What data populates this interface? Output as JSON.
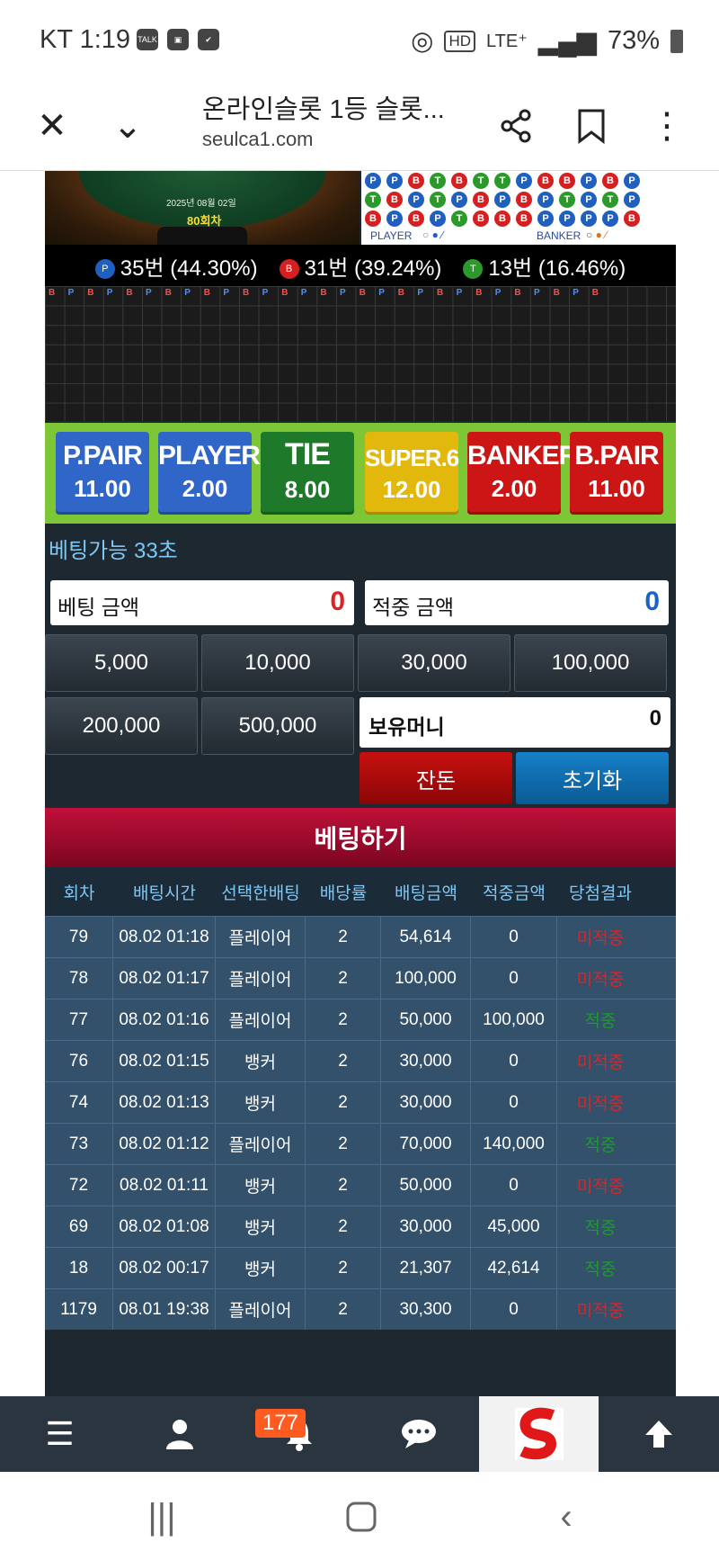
{
  "status_bar": {
    "carrier_time": "KT 1:19",
    "notif_icons": [
      "TALK",
      "▣",
      "✔"
    ],
    "hd": "HD",
    "network": "LTE⁺",
    "battery": "73%"
  },
  "browser": {
    "page_title": "온라인슬롯 1등 슬롯...",
    "url": "seulca1.com"
  },
  "game": {
    "table_date": "2025년 08월 02일",
    "round": "80회차",
    "bead_rows": [
      [
        "P",
        "P",
        "B",
        "T",
        "B",
        "T",
        "T",
        "P",
        "B",
        "B",
        "P",
        "B",
        "P"
      ],
      [
        "T",
        "B",
        "P",
        "T",
        "P",
        "B",
        "P",
        "B",
        "P",
        "T",
        "P",
        "T",
        "P"
      ],
      [
        "B",
        "P",
        "B",
        "P",
        "T",
        "B",
        "B",
        "B",
        "P",
        "P",
        "P",
        "P",
        "B"
      ]
    ],
    "bead_legend": {
      "player": "PLAYER",
      "banker": "BANKER"
    },
    "stats": [
      {
        "tag": "P",
        "text": "35번 (44.30%)",
        "color": "#1f5fbf"
      },
      {
        "tag": "B",
        "text": "31번 (39.24%)",
        "color": "#d42020"
      },
      {
        "tag": "T",
        "text": "13번 (16.46%)",
        "color": "#2b9a2b"
      }
    ],
    "road_header": [
      "B",
      "P",
      "B",
      "P",
      "B",
      "P",
      "B",
      "P",
      "B",
      "P",
      "B",
      "P",
      "B",
      "P",
      "B",
      "P",
      "B",
      "P",
      "B",
      "P",
      "B",
      "P",
      "B",
      "P",
      "B",
      "P",
      "B",
      "P",
      "B"
    ],
    "bet_options": [
      {
        "label": "P.PAIR",
        "odds": "11.00",
        "color": "#2f66c8"
      },
      {
        "label": "PLAYER",
        "odds": "2.00",
        "color": "#2f66c8"
      },
      {
        "label": "TIE",
        "odds": "8.00",
        "color": "#1e7a2a"
      },
      {
        "label": "SUPER.6",
        "odds": "12.00",
        "color": "#e2b80c"
      },
      {
        "label": "BANKER",
        "odds": "2.00",
        "color": "#cc1515"
      },
      {
        "label": "B.PAIR",
        "odds": "11.00",
        "color": "#cc1515"
      }
    ],
    "timer": "베팅가능 33초",
    "bet_amount_label": "베팅 금액",
    "bet_amount_value": "0",
    "win_amount_label": "적중 금액",
    "win_amount_value": "0",
    "chips": [
      "5,000",
      "10,000",
      "30,000",
      "100,000",
      "200,000",
      "500,000"
    ],
    "holding_label": "보유머니",
    "holding_value": "0",
    "change_label": "잔돈",
    "reset_label": "초기화",
    "place_bet_label": "베팅하기"
  },
  "history": {
    "headers": [
      "회차",
      "배팅시간",
      "선택한배팅",
      "배당률",
      "배팅금액",
      "적중금액",
      "당첨결과"
    ],
    "rows": [
      [
        "79",
        "08.02 01:18",
        "플레이어",
        "2",
        "54,614",
        "0",
        "미적중"
      ],
      [
        "78",
        "08.02 01:17",
        "플레이어",
        "2",
        "100,000",
        "0",
        "미적중"
      ],
      [
        "77",
        "08.02 01:16",
        "플레이어",
        "2",
        "50,000",
        "100,000",
        "적중"
      ],
      [
        "76",
        "08.02 01:15",
        "뱅커",
        "2",
        "30,000",
        "0",
        "미적중"
      ],
      [
        "74",
        "08.02 01:13",
        "뱅커",
        "2",
        "30,000",
        "0",
        "미적중"
      ],
      [
        "73",
        "08.02 01:12",
        "플레이어",
        "2",
        "70,000",
        "140,000",
        "적중"
      ],
      [
        "72",
        "08.02 01:11",
        "뱅커",
        "2",
        "50,000",
        "0",
        "미적중"
      ],
      [
        "69",
        "08.02 01:08",
        "뱅커",
        "2",
        "30,000",
        "45,000",
        "적중"
      ],
      [
        "18",
        "08.02 00:17",
        "뱅커",
        "2",
        "21,307",
        "42,614",
        "적중"
      ],
      [
        "1179",
        "08.01 19:38",
        "플레이어",
        "2",
        "30,300",
        "0",
        "미적중"
      ]
    ]
  },
  "bottom_nav": {
    "badge": "177",
    "items": [
      "menu-icon",
      "user-icon",
      "bell-icon",
      "chat-icon",
      "logo",
      "arrow-up-icon"
    ]
  },
  "colors": {
    "win": "#1e9a2e",
    "lose": "#d6262a",
    "accent": "#7ec7f5"
  }
}
